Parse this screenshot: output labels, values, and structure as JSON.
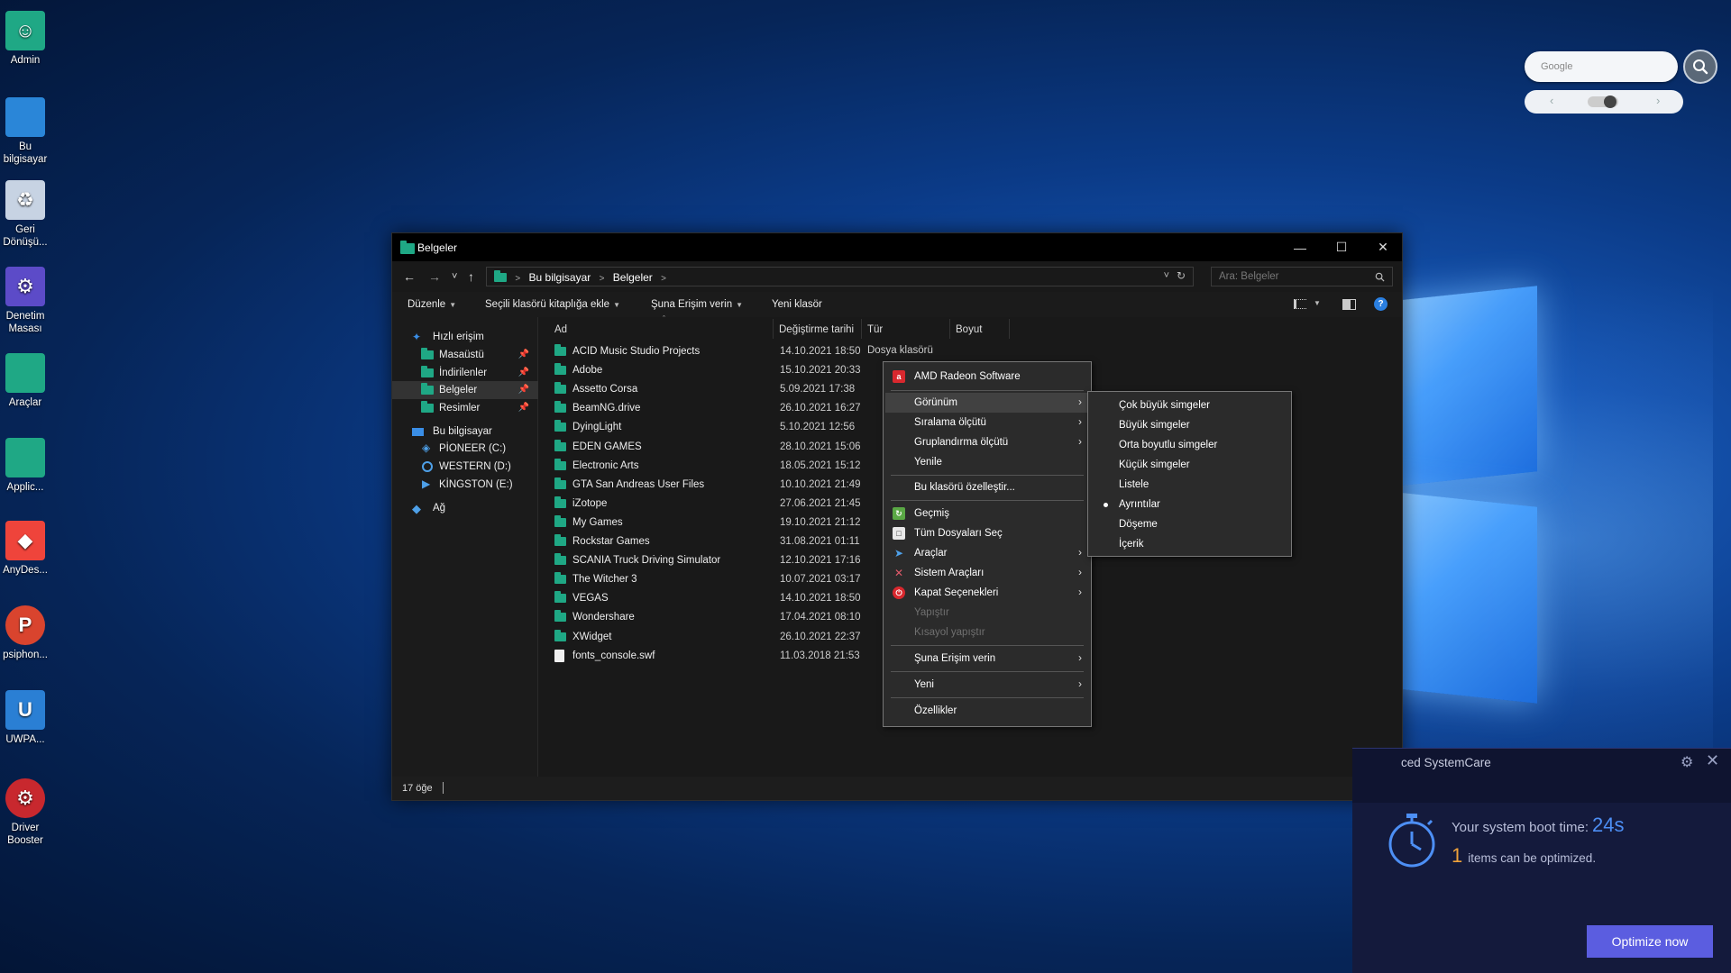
{
  "desktop": {
    "icons": [
      {
        "label": "Admin",
        "color": "#1fa885",
        "glyph": "☺"
      },
      {
        "label": "Bu bilgisayar",
        "color": "#2a86d8",
        "glyph": ""
      },
      {
        "label": "Geri Dönüşü...",
        "color": "#c7d3e3",
        "glyph": "♻"
      },
      {
        "label": "Denetim Masası",
        "color": "#5c4bc8",
        "glyph": "⚙"
      },
      {
        "label": "Araçlar",
        "color": "#1fa885",
        "glyph": ""
      },
      {
        "label": "Applic...",
        "color": "#1fa885",
        "glyph": ""
      },
      {
        "label": "AnyDes...",
        "color": "#ef443b",
        "glyph": "◆"
      },
      {
        "label": "psiphon...",
        "color": "#d9442e",
        "glyph": "P"
      },
      {
        "label": "UWPA...",
        "color": "#2a7fd4",
        "glyph": "U"
      },
      {
        "label": "Driver Booster",
        "color": "#c8282e",
        "glyph": "⚙"
      }
    ]
  },
  "widget": {
    "search_placeholder": "Google",
    "search_icon": "search-icon",
    "prev": "‹",
    "next": "›"
  },
  "explorer": {
    "title": "Belgeler",
    "window_controls": {
      "minimize": "—",
      "maximize": "☐",
      "close": "✕"
    },
    "nav": {
      "back": "←",
      "forward": "→",
      "recent": "˅",
      "up": "↑"
    },
    "address": {
      "segments": [
        "Bu bilgisayar",
        "Belgeler"
      ],
      "refresh": "↻",
      "dropdown": "˅"
    },
    "search_placeholder": "Ara: Belgeler",
    "commands": {
      "organize": "Düzenle",
      "add_to_library": "Seçili klasörü kitaplığa ekle",
      "share_with": "Şuna Erişim verin",
      "new_folder": "Yeni klasör"
    },
    "navpane": {
      "quick_access": "Hızlı erişim",
      "quick_items": [
        "Masaüstü",
        "İndirilenler",
        "Belgeler",
        "Resimler"
      ],
      "this_pc": "Bu bilgisayar",
      "drives": [
        "PİONEER (C:)",
        "WESTERN (D:)",
        "KİNGSTON (E:)"
      ],
      "network": "Ağ"
    },
    "columns": {
      "name": "Ad",
      "modified": "Değiştirme tarihi",
      "type": "Tür",
      "size": "Boyut"
    },
    "first_type": "Dosya klasörü",
    "files": [
      {
        "name": "ACID Music Studio Projects",
        "date": "14.10.2021 18:50",
        "kind": "folder"
      },
      {
        "name": "Adobe",
        "date": "15.10.2021 20:33",
        "kind": "folder"
      },
      {
        "name": "Assetto Corsa",
        "date": "5.09.2021 17:38",
        "kind": "folder"
      },
      {
        "name": "BeamNG.drive",
        "date": "26.10.2021 16:27",
        "kind": "folder"
      },
      {
        "name": "DyingLight",
        "date": "5.10.2021 12:56",
        "kind": "folder"
      },
      {
        "name": "EDEN GAMES",
        "date": "28.10.2021 15:06",
        "kind": "folder"
      },
      {
        "name": "Electronic Arts",
        "date": "18.05.2021 15:12",
        "kind": "folder"
      },
      {
        "name": "GTA San Andreas User Files",
        "date": "10.10.2021 21:49",
        "kind": "folder"
      },
      {
        "name": "iZotope",
        "date": "27.06.2021 21:45",
        "kind": "folder"
      },
      {
        "name": "My Games",
        "date": "19.10.2021 21:12",
        "kind": "folder"
      },
      {
        "name": "Rockstar Games",
        "date": "31.08.2021 01:11",
        "kind": "folder"
      },
      {
        "name": "SCANIA Truck Driving Simulator",
        "date": "12.10.2021 17:16",
        "kind": "folder"
      },
      {
        "name": "The Witcher 3",
        "date": "10.07.2021 03:17",
        "kind": "folder"
      },
      {
        "name": "VEGAS",
        "date": "14.10.2021 18:50",
        "kind": "folder"
      },
      {
        "name": "Wondershare",
        "date": "17.04.2021 08:10",
        "kind": "folder"
      },
      {
        "name": "XWidget",
        "date": "26.10.2021 22:37",
        "kind": "folder"
      },
      {
        "name": "fonts_console.swf",
        "date": "11.03.2018 21:53",
        "kind": "file"
      }
    ],
    "status": "17 öğe"
  },
  "context_menu": {
    "amd": "AMD Radeon Software",
    "view": "Görünüm",
    "sort_by": "Sıralama ölçütü",
    "group_by": "Gruplandırma ölçütü",
    "refresh": "Yenile",
    "customize": "Bu klasörü özelleştir...",
    "history": "Geçmiş",
    "select_all": "Tüm Dosyaları Seç",
    "tools": "Araçlar",
    "system_tools": "Sistem Araçları",
    "shutdown_options": "Kapat Seçenekleri",
    "paste": "Yapıştır",
    "paste_shortcut": "Kısayol yapıştır",
    "share_with": "Şuna Erişim verin",
    "new": "Yeni",
    "properties": "Özellikler"
  },
  "view_submenu": {
    "items": [
      "Çok büyük simgeler",
      "Büyük simgeler",
      "Orta boyutlu simgeler",
      "Küçük simgeler",
      "Listele",
      "Ayrıntılar",
      "Döşeme",
      "İçerik"
    ],
    "selected": "Ayrıntılar"
  },
  "systemcare": {
    "name": "ced SystemCare",
    "boot_label": "Your system boot time:",
    "boot_time": "24s",
    "items_count": "1",
    "items_label": "items can be optimized.",
    "button": "Optimize now"
  },
  "colors": {
    "accent": "#1fa885",
    "menu_bg": "#2b2b2b",
    "optimize": "#5b5de0"
  }
}
